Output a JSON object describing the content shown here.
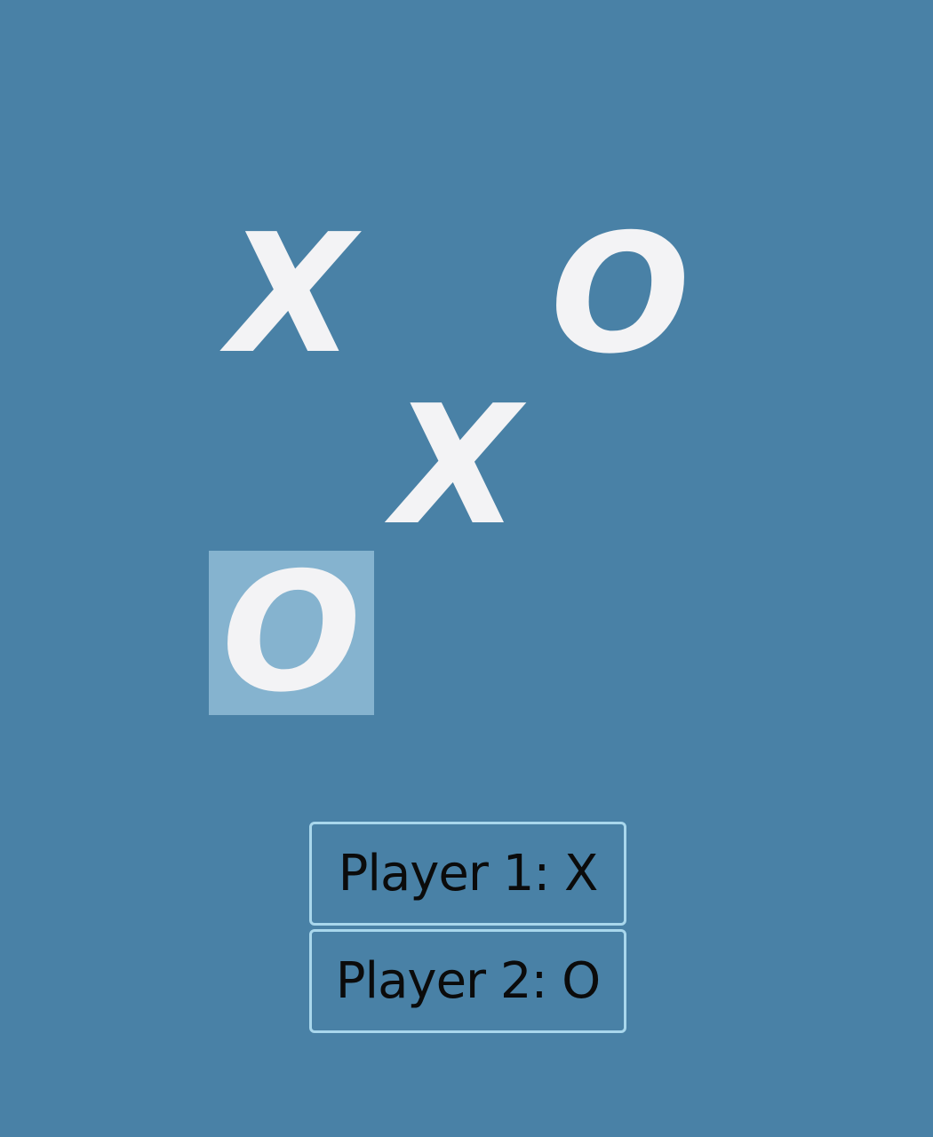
{
  "theme": {
    "background": "#4981a6",
    "mark_color": "#f3f3f5",
    "selected_cell_color": "#85b3cf",
    "player_box_border": "#a9d7ec",
    "player_text_color": "#0b0b0b"
  },
  "board": {
    "cells": [
      {
        "mark": "X",
        "selected": false
      },
      {
        "mark": "",
        "selected": false
      },
      {
        "mark": "O",
        "selected": false
      },
      {
        "mark": "",
        "selected": false
      },
      {
        "mark": "X",
        "selected": false
      },
      {
        "mark": "",
        "selected": false
      },
      {
        "mark": "O",
        "selected": true
      },
      {
        "mark": "",
        "selected": false
      },
      {
        "mark": "",
        "selected": false
      }
    ]
  },
  "players": [
    {
      "label": "Player 1: X"
    },
    {
      "label": "Player 2: O"
    }
  ]
}
